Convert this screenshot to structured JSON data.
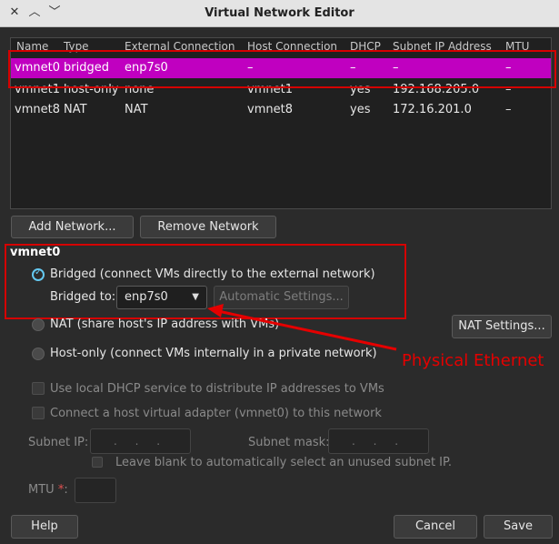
{
  "window": {
    "title": "Virtual Network Editor"
  },
  "table": {
    "headers": [
      "Name",
      "Type",
      "External Connection",
      "Host Connection",
      "DHCP",
      "Subnet IP Address",
      "MTU"
    ],
    "rows": [
      [
        "vmnet0",
        "bridged",
        "enp7s0",
        "–",
        "–",
        "–",
        "–"
      ],
      [
        "vmnet1",
        "host-only",
        "none",
        "vmnet1",
        "yes",
        "192.168.205.0",
        "–"
      ],
      [
        "vmnet8",
        "NAT",
        "NAT",
        "vmnet8",
        "yes",
        "172.16.201.0",
        "–"
      ]
    ],
    "selected_index": 0
  },
  "buttons": {
    "add_network": "Add Network...",
    "remove_network": "Remove Network",
    "help": "Help",
    "cancel": "Cancel",
    "save": "Save"
  },
  "settings": {
    "section_title": "vmnet0",
    "bridged_label": "Bridged (connect VMs directly to the external network)",
    "bridged_to_label": "Bridged to:",
    "bridged_to_value": "enp7s0",
    "automatic_settings": "Automatic Settings...",
    "nat_label": "NAT (share host's IP address with VMs)",
    "nat_settings": "NAT Settings...",
    "hostonly_label": "Host-only (connect VMs internally in a private network)",
    "dhcp_label": "Use local DHCP service to distribute IP addresses to VMs",
    "adapter_label": "Connect a host virtual adapter (vmnet0) to this network",
    "subnet_ip_label": "Subnet IP:",
    "subnet_mask_label": "Subnet mask:",
    "subnet_ip_dots": ". . .",
    "subnet_mask_dots": ". . .",
    "blank_hint": "Leave blank to automatically select an unused subnet IP.",
    "mtu_label": "MTU",
    "mtu_required": "*",
    "mtu_colon": ":"
  },
  "annotation": {
    "text": "Physical Ethernet",
    "color": "#e50000"
  },
  "colors": {
    "selection": "#c000c0",
    "accent": "#64c8f0"
  },
  "icons": {
    "minimize": "chevron-down-icon",
    "maximize": "chevron-up-icon",
    "close": "close-icon"
  }
}
